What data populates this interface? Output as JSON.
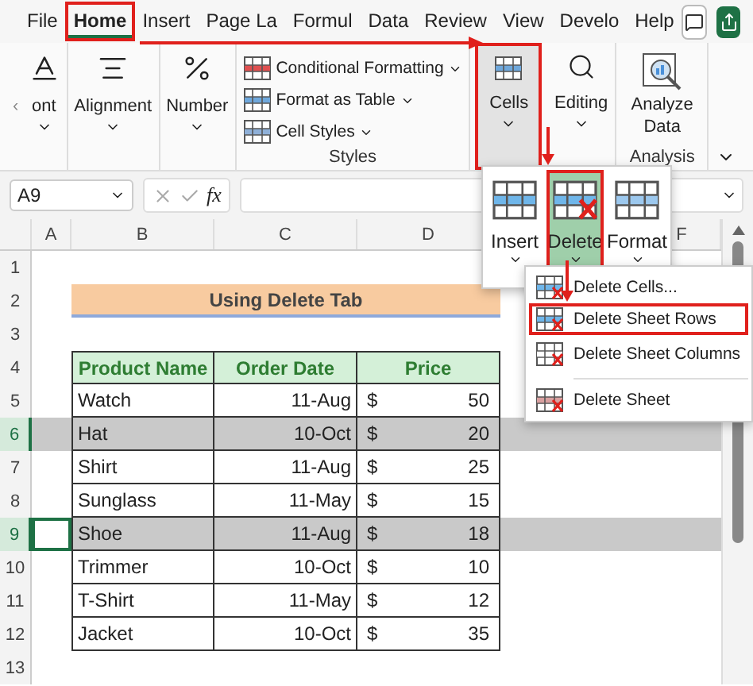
{
  "tabs": [
    {
      "label": "File",
      "selected": false,
      "highlighted": false
    },
    {
      "label": "Home",
      "selected": true,
      "highlighted": true
    },
    {
      "label": "Insert",
      "selected": false,
      "highlighted": false
    },
    {
      "label": "Page La",
      "selected": false,
      "highlighted": false
    },
    {
      "label": "Formul",
      "selected": false,
      "highlighted": false
    },
    {
      "label": "Data",
      "selected": false,
      "highlighted": false
    },
    {
      "label": "Review",
      "selected": false,
      "highlighted": false
    },
    {
      "label": "View",
      "selected": false,
      "highlighted": false
    },
    {
      "label": "Develo",
      "selected": false,
      "highlighted": false
    },
    {
      "label": "Help",
      "selected": false,
      "highlighted": false
    }
  ],
  "ribbon": {
    "scroll_left": "‹",
    "large_buttons": [
      {
        "label": "ont"
      },
      {
        "label": "Alignment"
      },
      {
        "label": "Number"
      }
    ],
    "styles": {
      "items": [
        {
          "label": "Conditional Formatting"
        },
        {
          "label": "Format as Table"
        },
        {
          "label": "Cell Styles"
        }
      ],
      "group_label": "Styles"
    },
    "cells": {
      "label": "Cells",
      "pressed": true,
      "highlighted": true
    },
    "editing": {
      "label": "Editing"
    },
    "analysis": {
      "button_label": "Analyze Data",
      "group_label": "Analysis"
    }
  },
  "formula_bar": {
    "name_box": "A9",
    "fx": "fx"
  },
  "cells_menu": {
    "buttons": [
      {
        "label": "Insert",
        "pressed": false,
        "highlighted": false
      },
      {
        "label": "Delete",
        "pressed": true,
        "highlighted": true
      },
      {
        "label": "Format",
        "pressed": false,
        "highlighted": false
      }
    ]
  },
  "delete_menu": {
    "items": [
      {
        "label": "Delete Cells...",
        "highlighted": false
      },
      {
        "label": "Delete Sheet Rows",
        "highlighted": true
      },
      {
        "label": "Delete Sheet Columns",
        "highlighted": false
      },
      {
        "label": "Delete Sheet",
        "highlighted": false
      }
    ]
  },
  "sheet": {
    "columns": [
      "A",
      "B",
      "C",
      "D",
      "F"
    ],
    "rows": [
      {
        "number": "1",
        "selected": false,
        "active": false
      },
      {
        "number": "2",
        "selected": false,
        "active": false
      },
      {
        "number": "3",
        "selected": false,
        "active": false
      },
      {
        "number": "4",
        "selected": false,
        "active": false
      },
      {
        "number": "5",
        "selected": false,
        "active": false
      },
      {
        "number": "6",
        "selected": true,
        "active": false
      },
      {
        "number": "7",
        "selected": false,
        "active": false
      },
      {
        "number": "8",
        "selected": false,
        "active": false
      },
      {
        "number": "9",
        "selected": true,
        "active": true
      },
      {
        "number": "10",
        "selected": false,
        "active": false
      },
      {
        "number": "11",
        "selected": false,
        "active": false
      },
      {
        "number": "12",
        "selected": false,
        "active": false
      },
      {
        "number": "13",
        "selected": false,
        "active": false
      }
    ],
    "title": "Using Delete Tab",
    "table": {
      "columns": [
        "Product Name",
        "Order Date",
        "Price"
      ],
      "rows": [
        {
          "product": "Watch",
          "date": "11-Aug",
          "currency": "$",
          "price": "50"
        },
        {
          "product": "Hat",
          "date": "10-Oct",
          "currency": "$",
          "price": "20"
        },
        {
          "product": "Shirt",
          "date": "11-Aug",
          "currency": "$",
          "price": "25"
        },
        {
          "product": "Sunglass",
          "date": "11-May",
          "currency": "$",
          "price": "15"
        },
        {
          "product": "Shoe",
          "date": "11-Aug",
          "currency": "$",
          "price": "18"
        },
        {
          "product": "Trimmer",
          "date": "10-Oct",
          "currency": "$",
          "price": "10"
        },
        {
          "product": "T-Shirt",
          "date": "11-May",
          "currency": "$",
          "price": "12"
        },
        {
          "product": "Jacket",
          "date": "10-Oct",
          "currency": "$",
          "price": "35"
        }
      ]
    }
  }
}
